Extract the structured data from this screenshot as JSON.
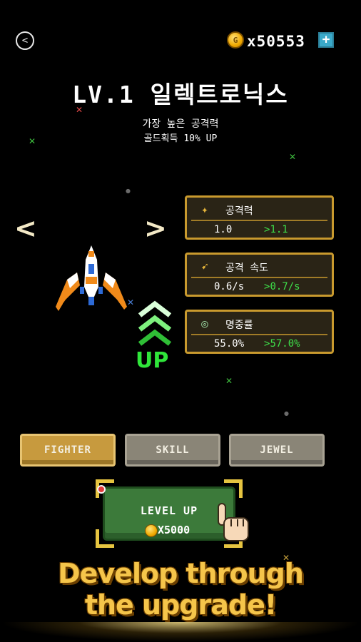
{
  "header": {
    "gold_amount": "x50553",
    "plus_label": "+",
    "back_icon": "back-arrow-icon",
    "coin_icon": "gold-coin-icon"
  },
  "ship": {
    "title": "LV.1 일렉트로닉스",
    "desc_line1": "가장 높은 공격력",
    "desc_line2": "골드획득 10% UP",
    "prev_arrow": "<",
    "next_arrow": ">"
  },
  "upgrade_indicator": {
    "text": "UP",
    "color": "#2fe63a"
  },
  "stats": [
    {
      "label": "공격력",
      "current": "1.0",
      "next": "1.1",
      "icon": "attack-icon"
    },
    {
      "label": "공격 속도",
      "current": "0.6/s",
      "next": "0.7/s",
      "icon": "attack-speed-icon"
    },
    {
      "label": "명중률",
      "current": "55.0%",
      "next": "57.0%",
      "icon": "accuracy-icon"
    }
  ],
  "tabs": [
    {
      "label": "FIGHTER",
      "active": true
    },
    {
      "label": "SKILL",
      "active": false
    },
    {
      "label": "JEWEL",
      "active": false
    }
  ],
  "level_up": {
    "label": "LEVEL UP",
    "cost": "X5000"
  },
  "promo": {
    "line1": "Develop through",
    "line2": "the upgrade!"
  },
  "colors": {
    "background": "#000000",
    "frame_gold": "#c99a2e",
    "stat_green": "#3ee04a",
    "promo_yellow": "#f5c54a",
    "active_tab": "#c79a3e",
    "inactive_tab": "#8a8577",
    "level_up_green": "#3c7a3a"
  }
}
